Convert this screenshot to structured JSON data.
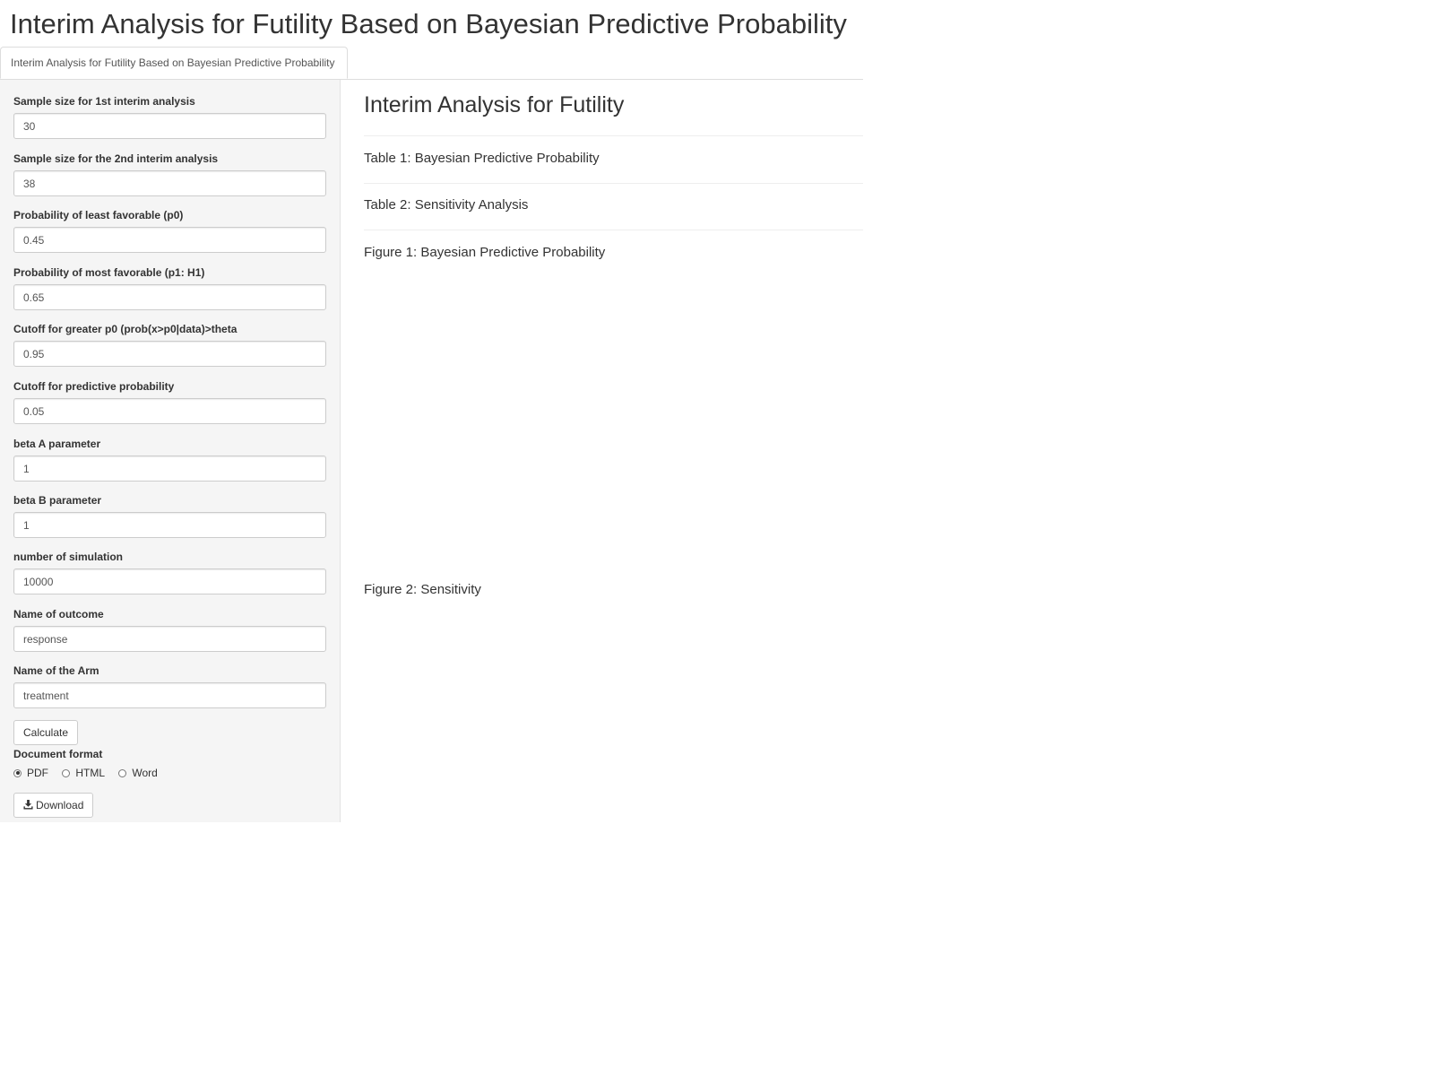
{
  "app": {
    "title": "Interim Analysis for Futility Based on Bayesian Predictive Probability"
  },
  "tabs": [
    {
      "label": "Interim Analysis for Futility Based on Bayesian Predictive Probability",
      "active": true
    }
  ],
  "sidebar": {
    "fields": [
      {
        "label": "Sample size for 1st interim analysis",
        "value": "30"
      },
      {
        "label": "Sample size for the 2nd interim analysis",
        "value": "38"
      },
      {
        "label": "Probability of least favorable (p0)",
        "value": "0.45"
      },
      {
        "label": "Probability of most favorable (p1: H1)",
        "value": "0.65"
      },
      {
        "label": "Cutoff for greater p0 (prob(x>p0|data)>theta",
        "value": "0.95"
      },
      {
        "label": "Cutoff for predictive probability",
        "value": "0.05"
      },
      {
        "label": "beta A parameter",
        "value": "1"
      },
      {
        "label": "beta B parameter",
        "value": "1"
      },
      {
        "label": "number of simulation",
        "value": "10000"
      },
      {
        "label": "Name of outcome",
        "value": "response"
      },
      {
        "label": "Name of the Arm",
        "value": "treatment"
      }
    ],
    "calculate_label": "Calculate",
    "format": {
      "label": "Document format",
      "options": [
        {
          "label": "PDF",
          "checked": true
        },
        {
          "label": "HTML",
          "checked": false
        },
        {
          "label": "Word",
          "checked": false
        }
      ]
    },
    "download_label": "Download",
    "download_icon": "download-icon"
  },
  "main": {
    "heading": "Interim Analysis for Futility",
    "items": [
      "Table 1: Bayesian Predictive Probability",
      "Table 2: Sensitivity Analysis",
      "Figure 1: Bayesian Predictive Probability",
      "Figure 2: Sensitivity"
    ]
  },
  "colors": {
    "sidebar_bg": "#f5f5f5",
    "border": "#cccccc",
    "text": "#333333"
  }
}
